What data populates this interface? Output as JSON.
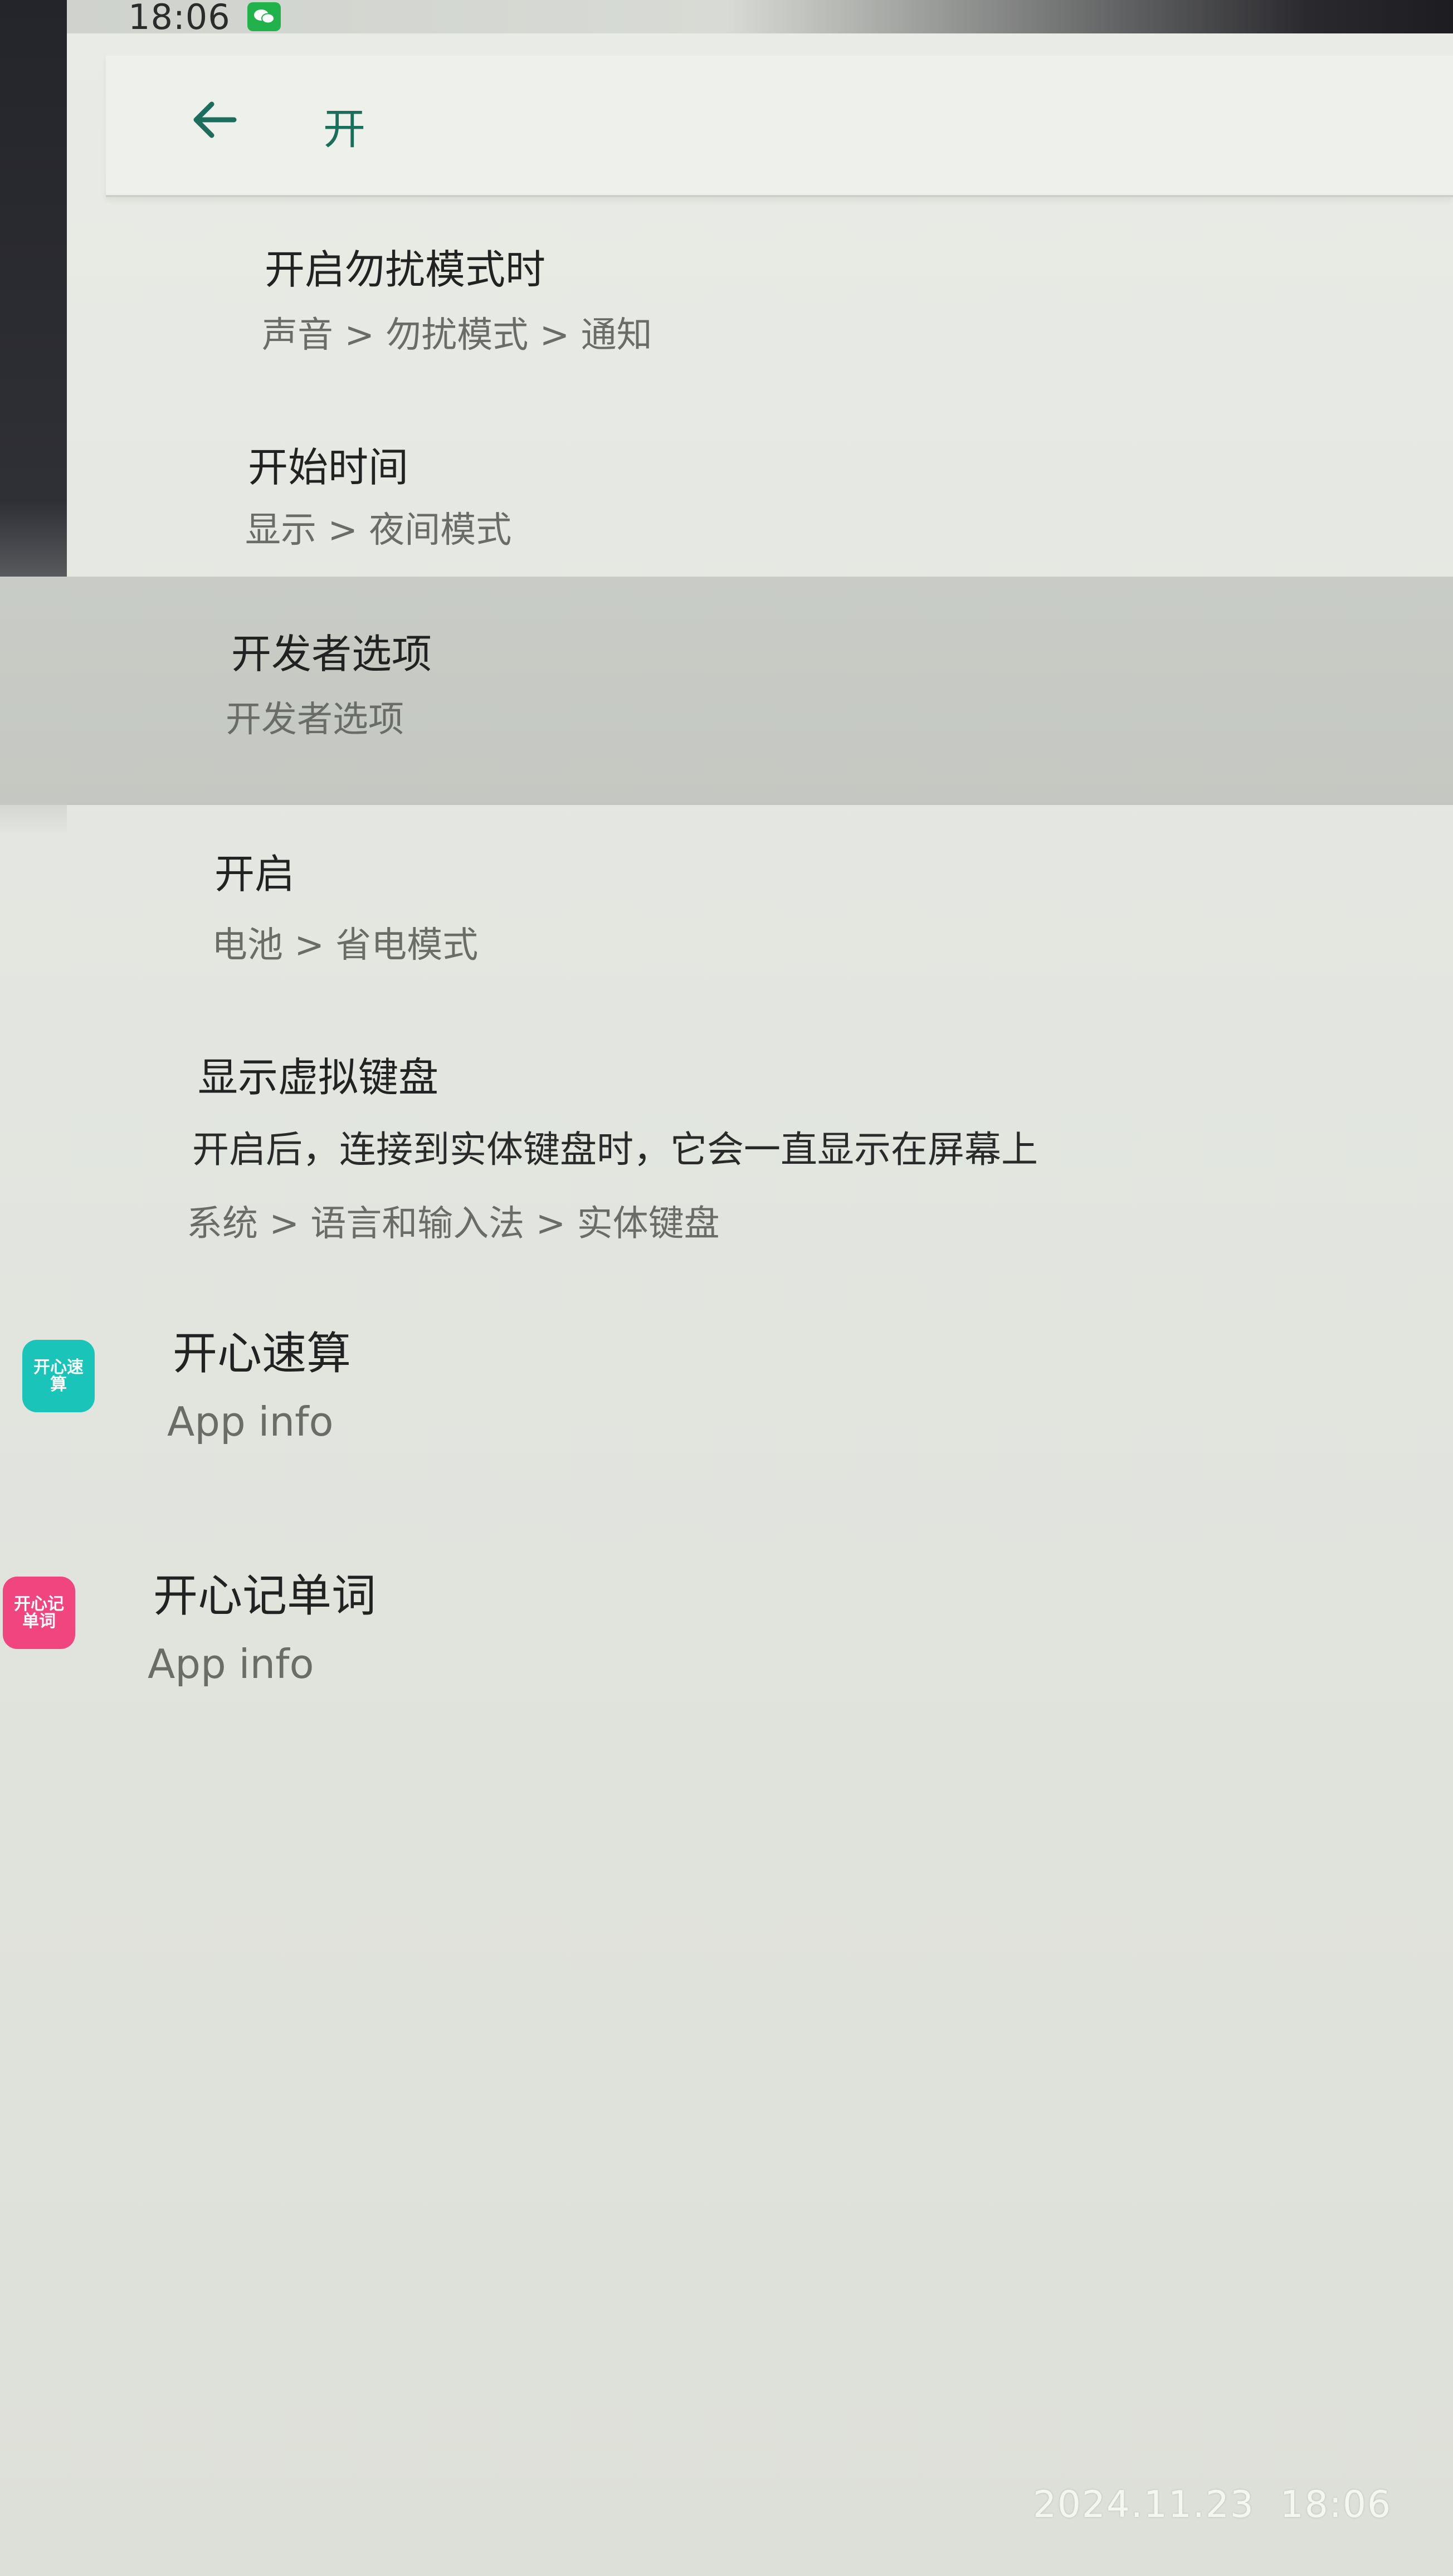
{
  "status_bar": {
    "time": "18:06",
    "notification_icon": "wechat-icon"
  },
  "toolbar": {
    "back_icon": "arrow-left-icon",
    "query": "开"
  },
  "results": [
    {
      "title": "开启勿扰模式时",
      "path": "声音 > 勿扰模式 > 通知"
    },
    {
      "title": "开始时间",
      "path": "显示 > 夜间模式"
    },
    {
      "title": "开发者选项",
      "path": "开发者选项",
      "highlighted": true
    },
    {
      "title": "开启",
      "path": "电池 > 省电模式"
    },
    {
      "title": "显示虚拟键盘",
      "summary": "开启后，连接到实体键盘时，它会一直显示在屏幕上",
      "path": "系统 > 语言和输入法 > 实体键盘"
    },
    {
      "title": "开心速算",
      "path": "App info",
      "icon_label": "开心速算",
      "icon_color": "#1bc4b8"
    },
    {
      "title": "开心记单词",
      "path": "App info",
      "icon_label": "开心记单词",
      "icon_color": "#f0457f"
    }
  ],
  "watermark": "2024.11.23  18:06",
  "colors": {
    "accent": "#1a6e5a",
    "highlight_row": "#c7cac4"
  }
}
